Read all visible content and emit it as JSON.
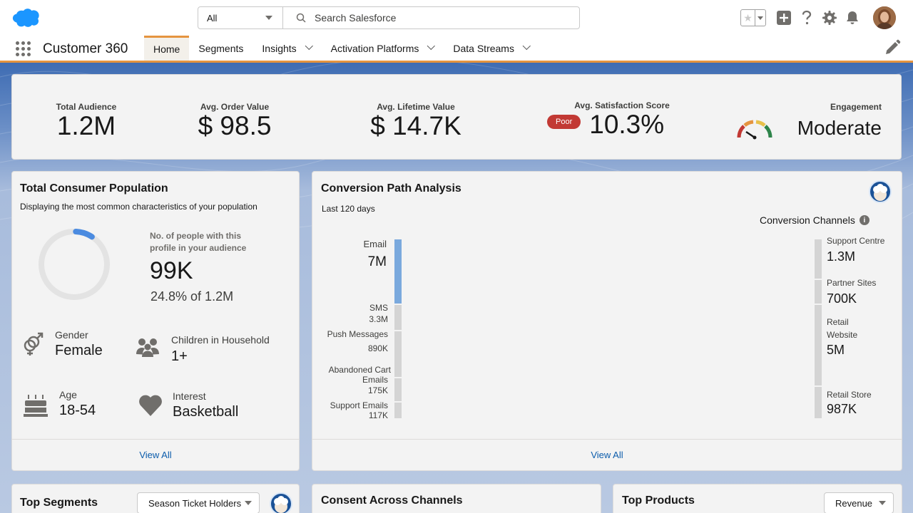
{
  "header": {
    "search_scope": "All",
    "search_placeholder": "Search Salesforce"
  },
  "nav": {
    "app_name": "Customer 360",
    "tabs": [
      {
        "label": "Home"
      },
      {
        "label": "Segments"
      },
      {
        "label": "Insights"
      },
      {
        "label": "Activation Platforms"
      },
      {
        "label": "Data Streams"
      }
    ]
  },
  "kpis": {
    "total_audience": {
      "label": "Total Audience",
      "value": "1.2M"
    },
    "avg_order_value": {
      "label": "Avg. Order Value",
      "value": "$ 98.5"
    },
    "avg_lifetime_value": {
      "label": "Avg. Lifetime Value",
      "value": "$ 14.7K"
    },
    "avg_satisfaction": {
      "label": "Avg. Satisfaction Score",
      "badge": "Poor",
      "value": "10.3%"
    },
    "engagement": {
      "label": "Engagement",
      "value": "Moderate"
    }
  },
  "population": {
    "title": "Total Consumer Population",
    "subtitle": "Displaying the most common characteristics of your population",
    "profile_label_line1": "No. of people with this",
    "profile_label_line2": "profile in your audience",
    "profile_count": "99K",
    "profile_pct": "24.8% of 1.2M",
    "profile_fraction": 0.083,
    "gender_label": "Gender",
    "gender_value": "Female",
    "children_label": "Children in Household",
    "children_value": "1+",
    "age_label": "Age",
    "age_value": "18-54",
    "interest_label": "Interest",
    "interest_value": "Basketball",
    "view_all": "View All"
  },
  "conversion": {
    "title": "Conversion Path Analysis",
    "period": "Last 120 days",
    "channels_heading": "Conversion Channels",
    "sources": [
      {
        "name": "Email",
        "value": "7M"
      },
      {
        "name": "SMS",
        "value": "3.3M"
      },
      {
        "name": "Push Messages",
        "value": "890K"
      },
      {
        "name": "Abandoned Cart Emails",
        "value": "175K"
      },
      {
        "name": "Support Emails",
        "value": "117K"
      }
    ],
    "targets": [
      {
        "name": "Support Centre",
        "value": "1.3M"
      },
      {
        "name": "Partner Sites",
        "value": "700K"
      },
      {
        "name": "Retail Website",
        "value": "5M"
      },
      {
        "name": "Retail Store",
        "value": "987K"
      }
    ],
    "abandoned_line1": "Abandoned Cart",
    "abandoned_line2": "Emails",
    "retail_web_line1": "Retail",
    "retail_web_line2": "Website",
    "view_all": "View All"
  },
  "top_segments": {
    "title": "Top Segments",
    "selected": "Season Ticket Holders"
  },
  "consent": {
    "title": "Consent Across Channels"
  },
  "top_products": {
    "title": "Top Products",
    "selected": "Revenue"
  },
  "colors": {
    "accent_orange": "#e5943f",
    "poor_red": "#c23934",
    "bar_blue": "#7aa9dd",
    "bar_grey": "#d4d4d4",
    "link_blue": "#0b5cab"
  }
}
